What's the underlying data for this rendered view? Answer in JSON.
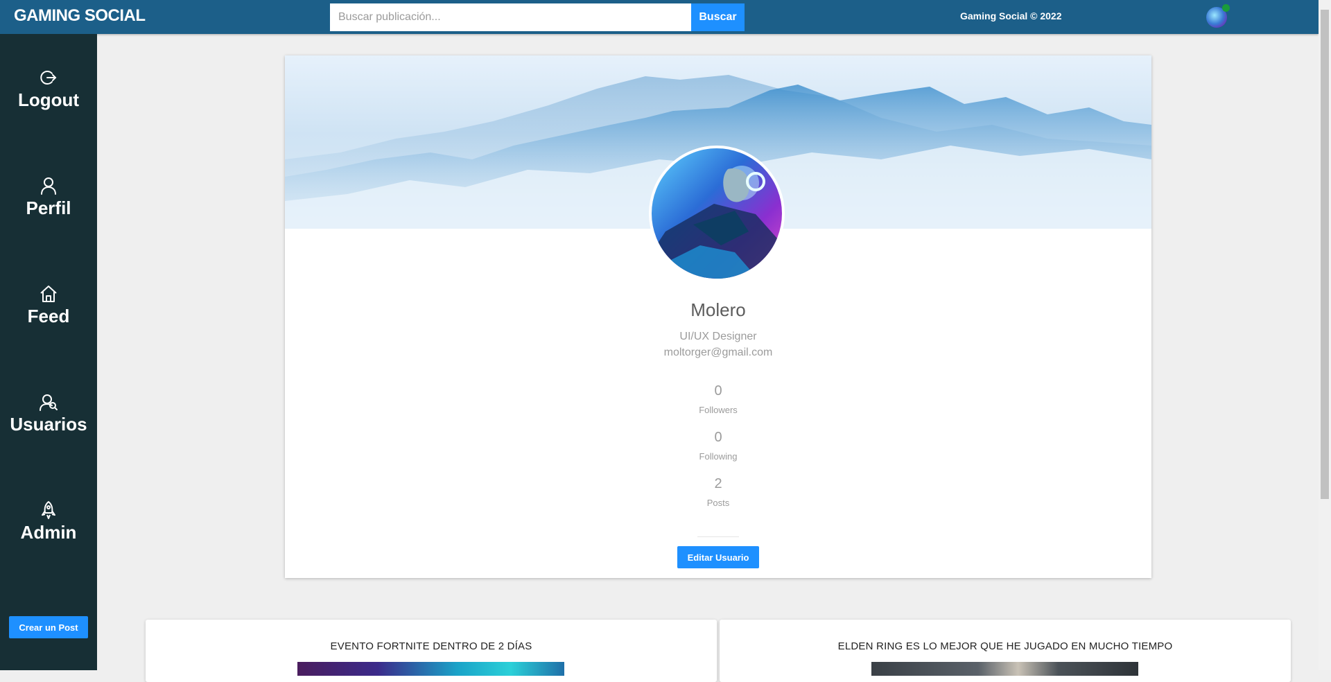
{
  "header": {
    "brand": "GAMING SOCIAL",
    "search_placeholder": "Buscar publicación...",
    "search_button": "Buscar",
    "copyright": "Gaming Social © 2022"
  },
  "sidebar": {
    "items": [
      {
        "label": "Logout",
        "icon": "logout-icon"
      },
      {
        "label": "Perfil",
        "icon": "user-icon"
      },
      {
        "label": "Feed",
        "icon": "home-icon"
      },
      {
        "label": "Usuarios",
        "icon": "users-icon"
      },
      {
        "label": "Admin",
        "icon": "rocket-icon"
      }
    ],
    "create_post": "Crear un Post"
  },
  "profile": {
    "name": "Molero",
    "role": "UI/UX Designer",
    "email": "moltorger@gmail.com",
    "stats": [
      {
        "value": "0",
        "label": "Followers"
      },
      {
        "value": "0",
        "label": "Following"
      },
      {
        "value": "2",
        "label": "Posts"
      }
    ],
    "edit_button": "Editar Usuario"
  },
  "posts": [
    {
      "title": "EVENTO FORTNITE DENTRO DE 2 DÍAS"
    },
    {
      "title": "ELDEN RING ES LO MEJOR QUE HE JUGADO EN MUCHO TIEMPO"
    }
  ],
  "colors": {
    "topbar": "#1c5f89",
    "sidebar": "#172f35",
    "accent": "#1e90ff"
  }
}
